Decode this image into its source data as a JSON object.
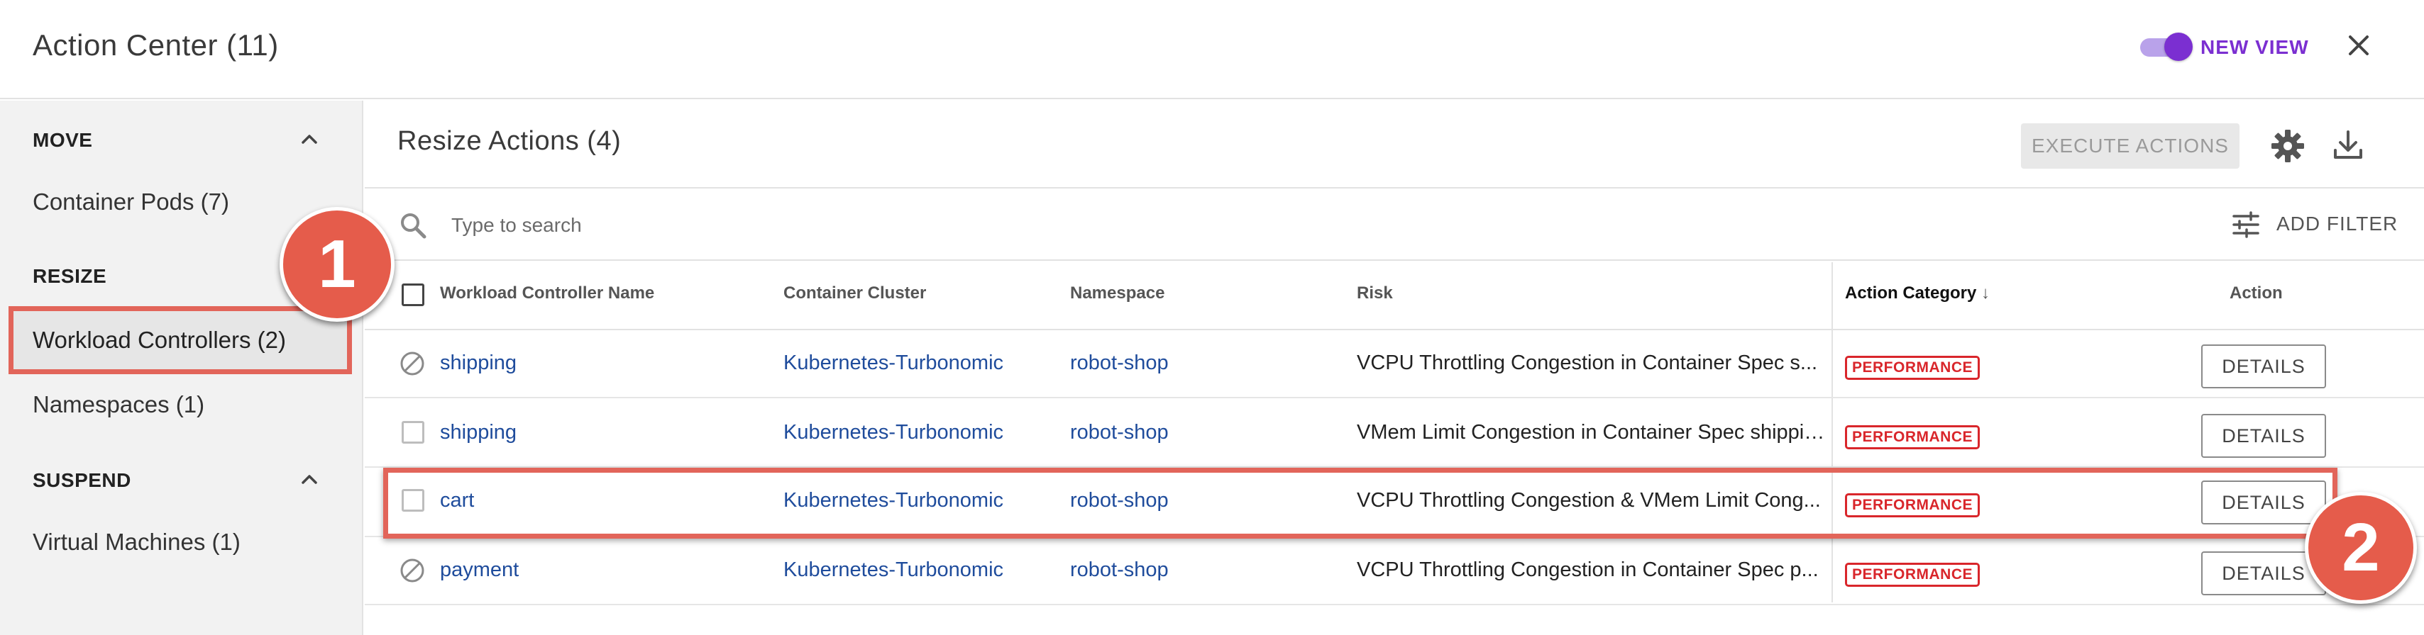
{
  "header": {
    "title": "Action Center (11)",
    "new_view_label": "NEW VIEW",
    "toggle_on": true
  },
  "sidebar": {
    "sections": [
      {
        "heading": "MOVE",
        "items": [
          {
            "label": "Container Pods (7)"
          }
        ]
      },
      {
        "heading": "RESIZE",
        "items": [
          {
            "label": "Workload Controllers (2)",
            "selected": true
          },
          {
            "label": "Namespaces (1)"
          }
        ]
      },
      {
        "heading": "SUSPEND",
        "items": [
          {
            "label": "Virtual Machines (1)"
          }
        ]
      }
    ]
  },
  "annotations": {
    "badge1": "1",
    "badge2": "2"
  },
  "main": {
    "title": "Resize Actions (4)",
    "execute_label": "EXECUTE ACTIONS",
    "search_placeholder": "Type to search",
    "add_filter_label": "ADD FILTER",
    "columns": [
      "Workload Controller Name",
      "Container Cluster",
      "Namespace",
      "Risk",
      "Action Category",
      "Action"
    ],
    "rows": [
      {
        "name": "shipping",
        "cluster": "Kubernetes-Turbonomic",
        "namespace": "robot-shop",
        "risk": "VCPU Throttling Congestion in Container Spec s...",
        "category": "PERFORMANCE",
        "action": "DETAILS",
        "selectable": false
      },
      {
        "name": "shipping",
        "cluster": "Kubernetes-Turbonomic",
        "namespace": "robot-shop",
        "risk": "VMem Limit Congestion in Container Spec shipping",
        "category": "PERFORMANCE",
        "action": "DETAILS",
        "selectable": true
      },
      {
        "name": "cart",
        "cluster": "Kubernetes-Turbonomic",
        "namespace": "robot-shop",
        "risk": "VCPU Throttling Congestion & VMem Limit Cong...",
        "category": "PERFORMANCE",
        "action": "DETAILS",
        "selectable": true
      },
      {
        "name": "payment",
        "cluster": "Kubernetes-Turbonomic",
        "namespace": "robot-shop",
        "risk": "VCPU Throttling Congestion in Container Spec p...",
        "category": "PERFORMANCE",
        "action": "DETAILS",
        "selectable": false
      }
    ]
  },
  "colors": {
    "accent": "#7b2fd1",
    "highlight": "#e2655a",
    "performance": "#d9262b",
    "link": "#1f4c9c"
  }
}
